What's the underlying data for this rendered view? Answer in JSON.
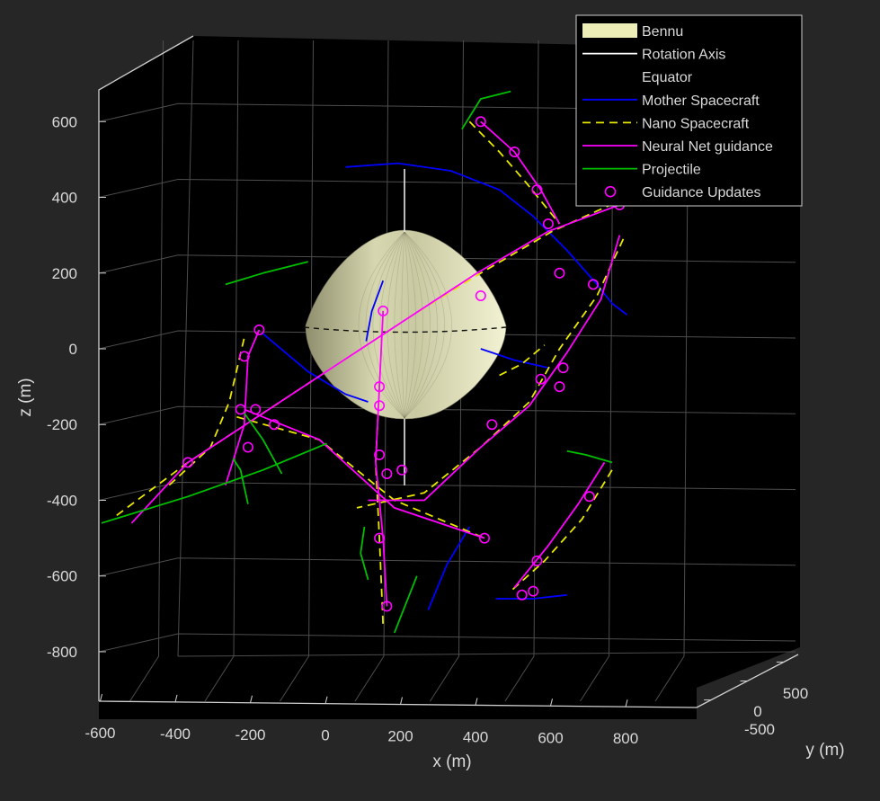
{
  "chart_data": {
    "type": "line",
    "projection": "3d",
    "xlabel": "x (m)",
    "ylabel": "y (m)",
    "zlabel": "z (m)",
    "xlim": [
      -650,
      850
    ],
    "ylim": [
      -700,
      700
    ],
    "zlim": [
      -850,
      650
    ],
    "xticks": [
      "-600",
      "-400",
      "-200",
      "0",
      "200",
      "400",
      "600",
      "800"
    ],
    "yticks": [
      "-500",
      "0",
      "500"
    ],
    "zticks": [
      "600",
      "400",
      "200",
      "0",
      "-200",
      "-400",
      "-600",
      "-800"
    ],
    "grid": true,
    "legend_position": "top-right",
    "legend": [
      {
        "name": "Bennu",
        "style": "patch",
        "color": "#ededb8"
      },
      {
        "name": "Rotation Axis",
        "style": "solid",
        "color": "#ffffff"
      },
      {
        "name": "Equator",
        "style": "dashed",
        "color": "#000000"
      },
      {
        "name": "Mother Spacecraft",
        "style": "solid",
        "color": "#0000ff"
      },
      {
        "name": "Nano Spacecraft",
        "style": "dashed",
        "color": "#e8e800"
      },
      {
        "name": "Neural Net guidance",
        "style": "solid",
        "color": "#ff00ff"
      },
      {
        "name": "Projectile",
        "style": "solid",
        "color": "#00c000"
      },
      {
        "name": "Guidance Updates",
        "style": "marker",
        "color": "#ff00ff"
      }
    ],
    "series": [
      {
        "name": "Mother Spacecraft",
        "color": "#0000ff",
        "segments": [
          [
            [
              -30,
              480
            ],
            [
              110,
              490
            ],
            [
              250,
              470
            ],
            [
              380,
              420
            ],
            [
              470,
              350
            ],
            [
              560,
              260
            ],
            [
              640,
              170
            ],
            [
              680,
              120
            ],
            [
              720,
              90
            ]
          ],
          [
            [
              -250,
              40
            ],
            [
              -130,
              -60
            ],
            [
              -30,
              -120
            ],
            [
              30,
              -140
            ]
          ],
          [
            [
              70,
              180
            ],
            [
              40,
              100
            ],
            [
              25,
              20
            ]
          ],
          [
            [
              330,
              0
            ],
            [
              420,
              -30
            ],
            [
              510,
              -50
            ]
          ],
          [
            [
              190,
              -690
            ],
            [
              240,
              -570
            ],
            [
              300,
              -470
            ]
          ],
          [
            [
              370,
              -660
            ],
            [
              470,
              -660
            ],
            [
              560,
              -650
            ]
          ]
        ]
      },
      {
        "name": "Nano Spacecraft",
        "color": "#e8e800",
        "dashed": true,
        "segments": [
          [
            [
              -640,
              -440
            ],
            [
              -450,
              -300
            ],
            [
              -250,
              -170
            ],
            [
              -50,
              -40
            ],
            [
              150,
              90
            ],
            [
              330,
              200
            ],
            [
              520,
              310
            ],
            [
              720,
              400
            ]
          ],
          [
            [
              -320,
              -180
            ],
            [
              -100,
              -240
            ],
            [
              100,
              -400
            ],
            [
              340,
              -500
            ]
          ],
          [
            [
              300,
              600
            ],
            [
              380,
              520
            ],
            [
              450,
              440
            ],
            [
              540,
              330
            ]
          ],
          [
            [
              710,
              290
            ],
            [
              640,
              140
            ],
            [
              540,
              0
            ],
            [
              460,
              -140
            ],
            [
              330,
              -260
            ],
            [
              180,
              -380
            ],
            [
              0,
              -420
            ]
          ],
          [
            [
              60,
              -100
            ],
            [
              50,
              -300
            ],
            [
              60,
              -500
            ],
            [
              70,
              -730
            ]
          ],
          [
            [
              -500,
              -360
            ],
            [
              -390,
              -260
            ],
            [
              -340,
              -140
            ],
            [
              -300,
              30
            ]
          ],
          [
            [
              680,
              -320
            ],
            [
              600,
              -450
            ],
            [
              500,
              -560
            ],
            [
              410,
              -640
            ]
          ],
          [
            [
              380,
              -70
            ],
            [
              440,
              -40
            ],
            [
              500,
              10
            ]
          ]
        ]
      },
      {
        "name": "Neural Net guidance",
        "color": "#ff00ff",
        "segments": [
          [
            [
              -600,
              -460
            ],
            [
              -450,
              -300
            ],
            [
              -250,
              -170
            ],
            [
              -50,
              -40
            ],
            [
              150,
              90
            ],
            [
              320,
              200
            ],
            [
              510,
              310
            ],
            [
              700,
              380
            ]
          ],
          [
            [
              -300,
              -160
            ],
            [
              -100,
              -240
            ],
            [
              100,
              -420
            ],
            [
              340,
              -500
            ]
          ],
          [
            [
              330,
              600
            ],
            [
              420,
              520
            ],
            [
              490,
              420
            ],
            [
              540,
              330
            ]
          ],
          [
            [
              700,
              300
            ],
            [
              650,
              130
            ],
            [
              560,
              -10
            ],
            [
              460,
              -150
            ],
            [
              330,
              -260
            ],
            [
              180,
              -400
            ],
            [
              30,
              -400
            ]
          ],
          [
            [
              70,
              100
            ],
            [
              60,
              -100
            ],
            [
              50,
              -300
            ],
            [
              70,
              -500
            ],
            [
              80,
              -680
            ]
          ],
          [
            [
              -350,
              -360
            ],
            [
              -300,
              -200
            ],
            [
              -290,
              -20
            ],
            [
              -260,
              50
            ]
          ],
          [
            [
              660,
              -300
            ],
            [
              590,
              -410
            ],
            [
              510,
              -520
            ],
            [
              420,
              -630
            ]
          ]
        ]
      },
      {
        "name": "Projectile",
        "color": "#00c000",
        "segments": [
          [
            [
              -680,
              -460
            ],
            [
              -450,
              -390
            ],
            [
              -250,
              -320
            ],
            [
              -80,
              -250
            ]
          ],
          [
            [
              -300,
              -170
            ],
            [
              -250,
              -240
            ],
            [
              -200,
              -330
            ]
          ],
          [
            [
              -330,
              -290
            ],
            [
              -310,
              -320
            ],
            [
              -290,
              -410
            ]
          ],
          [
            [
              -350,
              170
            ],
            [
              -250,
              200
            ],
            [
              -130,
              230
            ]
          ],
          [
            [
              280,
              580
            ],
            [
              330,
              660
            ],
            [
              410,
              680
            ]
          ],
          [
            [
              20,
              -470
            ],
            [
              10,
              -540
            ],
            [
              30,
              -610
            ]
          ],
          [
            [
              160,
              -600
            ],
            [
              120,
              -700
            ],
            [
              100,
              -750
            ]
          ],
          [
            [
              560,
              -270
            ],
            [
              610,
              -280
            ],
            [
              680,
              -300
            ]
          ]
        ]
      },
      {
        "name": "Guidance Updates",
        "color": "#ff00ff",
        "markers": true,
        "points": [
          [
            330,
            600
          ],
          [
            420,
            520
          ],
          [
            480,
            420
          ],
          [
            510,
            330
          ],
          [
            540,
            200
          ],
          [
            700,
            380
          ],
          [
            630,
            170
          ],
          [
            330,
            140
          ],
          [
            70,
            100
          ],
          [
            60,
            -100
          ],
          [
            60,
            -150
          ],
          [
            60,
            -280
          ],
          [
            80,
            -330
          ],
          [
            120,
            -320
          ],
          [
            60,
            -500
          ],
          [
            80,
            -680
          ],
          [
            -260,
            50
          ],
          [
            -300,
            -20
          ],
          [
            -310,
            -160
          ],
          [
            -270,
            -160
          ],
          [
            -290,
            -260
          ],
          [
            -220,
            -200
          ],
          [
            -450,
            -300
          ],
          [
            540,
            -100
          ],
          [
            490,
            -80
          ],
          [
            550,
            -50
          ],
          [
            360,
            -200
          ],
          [
            340,
            -500
          ],
          [
            480,
            -560
          ],
          [
            470,
            -640
          ],
          [
            440,
            -650
          ],
          [
            620,
            -390
          ]
        ]
      }
    ]
  }
}
